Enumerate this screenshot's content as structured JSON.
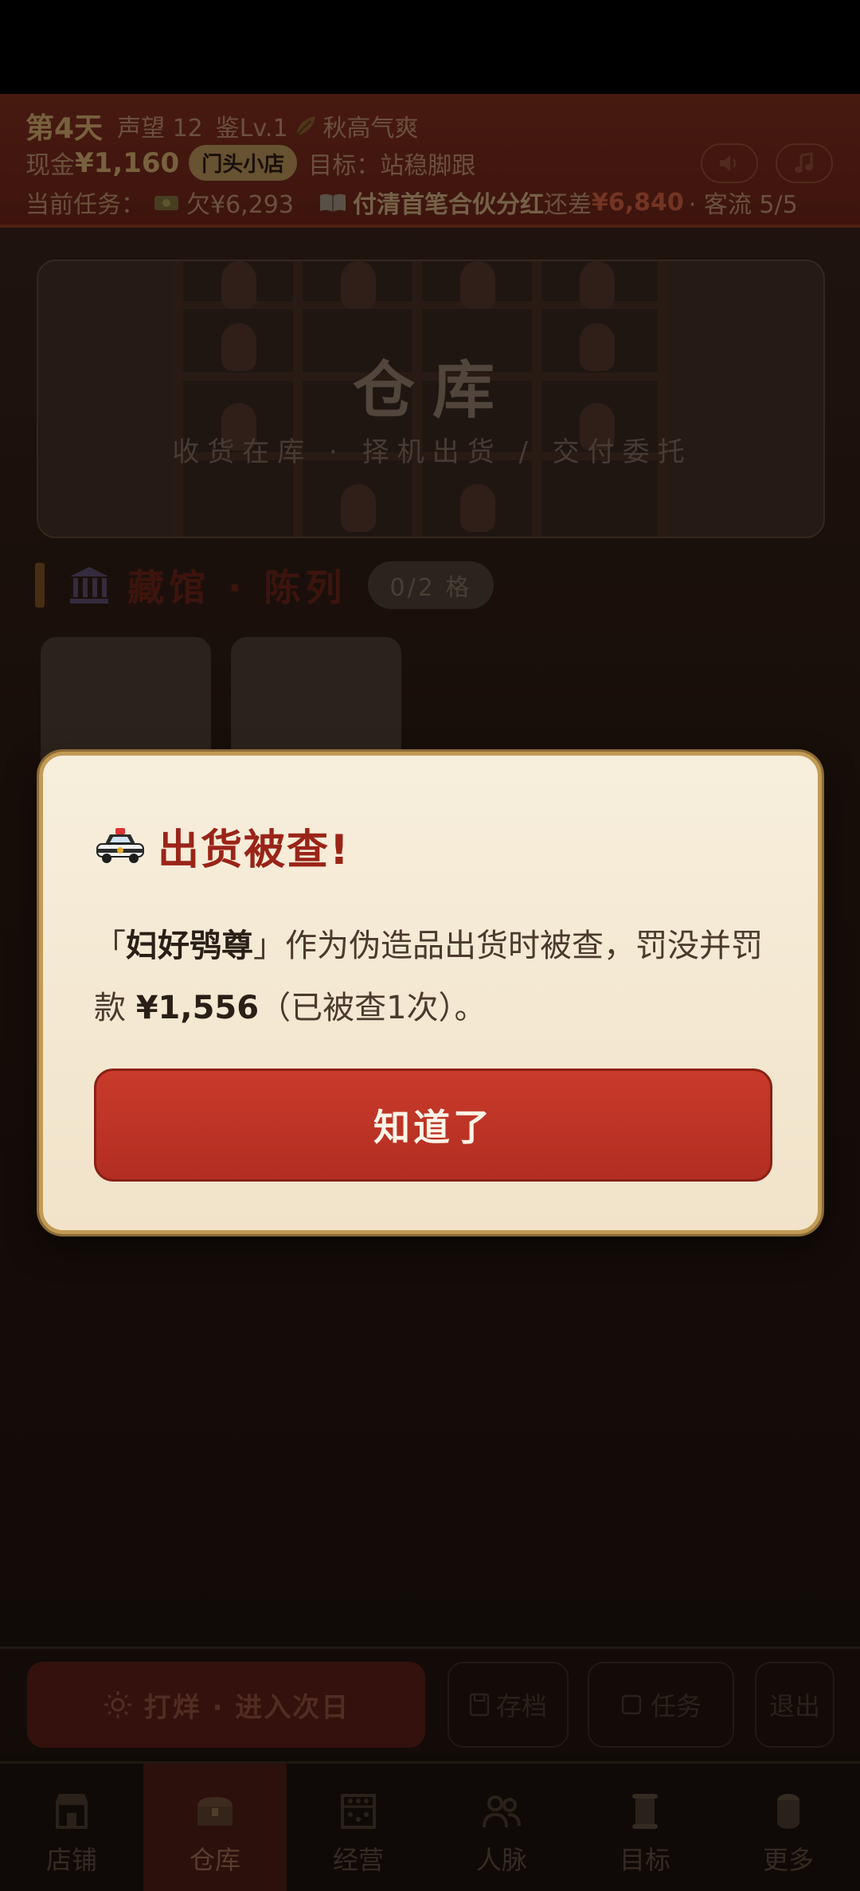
{
  "header": {
    "day": "第4天",
    "reputation": "声望 12",
    "appraisal": "鉴Lv.1",
    "season": "秋高气爽",
    "cash_label": "现金",
    "cash_value": "¥1,160",
    "shop_badge": "门头小店",
    "goal": "目标：站稳脚跟",
    "task_label": "当前任务：",
    "task_debt": "欠¥6,293",
    "task_book": "付清首笔合伙分红",
    "task_gap": "还差",
    "task_amount": "¥6,840",
    "task_flow": "· 客流 5/5"
  },
  "banner": {
    "title": "仓库",
    "subtitle": "收货在库 · 择机出货 / 交付委托"
  },
  "section": {
    "title": "藏馆 · 陈列",
    "count": "0/2 格"
  },
  "actions": {
    "next_day": "打烊 · 进入次日",
    "save": "存档",
    "task": "任务",
    "quit": "退出"
  },
  "tabs": [
    {
      "label": "店铺"
    },
    {
      "label": "仓库"
    },
    {
      "label": "经营"
    },
    {
      "label": "人脉"
    },
    {
      "label": "目标"
    },
    {
      "label": "更多"
    }
  ],
  "modal": {
    "title": "出货被查!",
    "item_open": "「",
    "item_name": "妇好鸮尊",
    "item_close": "」",
    "body_part1": "作为伪造品出货时被查，罚没并罚款",
    "fine": "¥1,556",
    "body_part2": "（已被查1次）。",
    "confirm": "知道了"
  },
  "colors": {
    "header_red": "#7b2d1d",
    "accent_gold": "#cfa86b",
    "modal_bg": "#f7eedc",
    "modal_border": "#c29a55",
    "button_red": "#c93a2a",
    "title_red": "#9a2418"
  }
}
